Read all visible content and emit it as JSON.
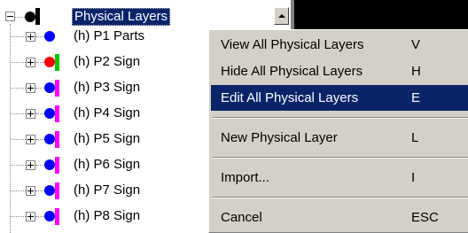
{
  "tree": {
    "root": {
      "label": "Physical Layers",
      "dot_color": "#000000",
      "bar_color": "#000000",
      "selected": true
    },
    "items": [
      {
        "label": "(h) P1 Parts",
        "dot_color": "#0000ff",
        "bar_color": ""
      },
      {
        "label": "(h) P2 Sign",
        "dot_color": "#ff0000",
        "bar_color": "#00cc00"
      },
      {
        "label": "(h) P3 Sign",
        "dot_color": "#0000ff",
        "bar_color": "#ff00ff"
      },
      {
        "label": "(h) P4 Sign",
        "dot_color": "#0000ff",
        "bar_color": "#ff00ff"
      },
      {
        "label": "(h) P5 Sign",
        "dot_color": "#0000ff",
        "bar_color": "#ff00ff"
      },
      {
        "label": "(h) P6 Sign",
        "dot_color": "#0000ff",
        "bar_color": "#ff00ff"
      },
      {
        "label": "(h) P7 Sign",
        "dot_color": "#0000ff",
        "bar_color": "#ff00ff"
      },
      {
        "label": "(h) P8 Sign",
        "dot_color": "#0000ff",
        "bar_color": "#ff00ff"
      }
    ]
  },
  "scrollbar": {
    "up_icon": "triangle-up"
  },
  "context_menu": {
    "items": [
      {
        "label": "View All Physical Layers",
        "shortcut": "V",
        "highlighted": false
      },
      {
        "label": "Hide All Physical Layers",
        "shortcut": "H",
        "highlighted": false
      },
      {
        "label": "Edit All Physical Layers",
        "shortcut": "E",
        "highlighted": true
      },
      {
        "separator": true
      },
      {
        "label": "New Physical Layer",
        "shortcut": "L",
        "highlighted": false
      },
      {
        "separator": true
      },
      {
        "label": "Import...",
        "shortcut": "I",
        "highlighted": false
      },
      {
        "separator": true
      },
      {
        "label": "Cancel",
        "shortcut": "ESC",
        "highlighted": false
      }
    ]
  },
  "colors": {
    "menu_bg": "#d4d0c8",
    "highlight_bg": "#0a246a",
    "highlight_text": "#ffffff"
  }
}
